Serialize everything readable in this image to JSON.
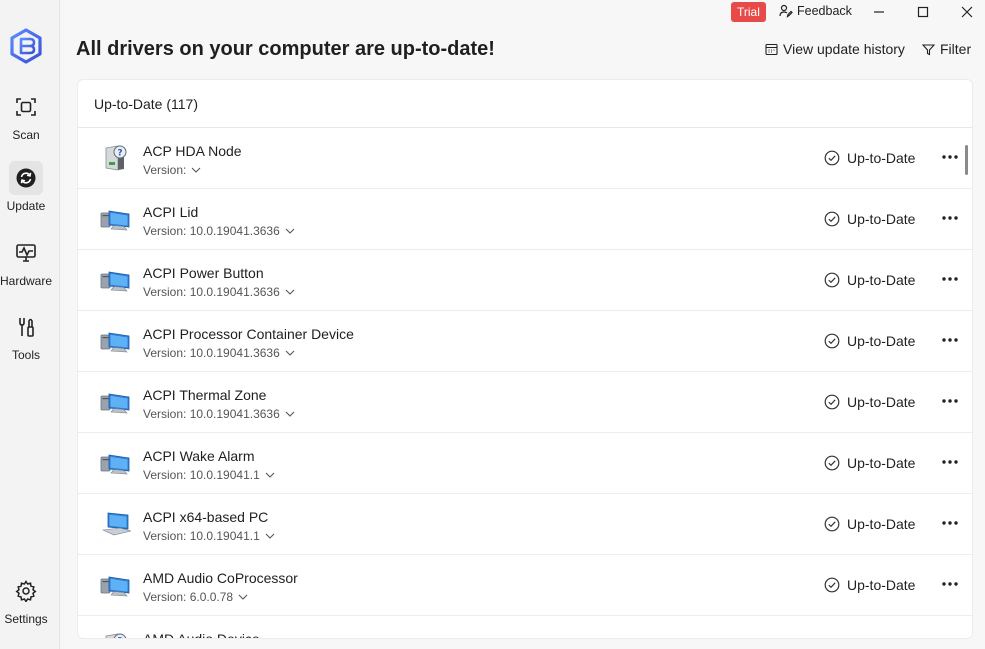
{
  "sidebar": {
    "items": [
      {
        "label": "Scan",
        "icon": "scan-icon"
      },
      {
        "label": "Update",
        "icon": "update-icon"
      },
      {
        "label": "Hardware",
        "icon": "hardware-icon"
      },
      {
        "label": "Tools",
        "icon": "tools-icon"
      }
    ],
    "settings_label": "Settings"
  },
  "titlebar": {
    "trial_label": "Trial",
    "feedback_label": "Feedback"
  },
  "header": {
    "headline": "All drivers on your computer are up-to-date!",
    "view_history_label": "View update history",
    "filter_label": "Filter"
  },
  "panel": {
    "section_title": "Up-to-Date (117)",
    "drivers": [
      {
        "name": "ACP HDA Node",
        "version": "Version:",
        "status": "Up-to-Date",
        "icon": "speaker-device-icon"
      },
      {
        "name": "ACPI Lid",
        "version": "Version: 10.0.19041.3636",
        "status": "Up-to-Date",
        "icon": "computer-monitor-icon"
      },
      {
        "name": "ACPI Power Button",
        "version": "Version: 10.0.19041.3636",
        "status": "Up-to-Date",
        "icon": "computer-monitor-icon"
      },
      {
        "name": "ACPI Processor Container Device",
        "version": "Version: 10.0.19041.3636",
        "status": "Up-to-Date",
        "icon": "computer-monitor-icon"
      },
      {
        "name": "ACPI Thermal Zone",
        "version": "Version: 10.0.19041.3636",
        "status": "Up-to-Date",
        "icon": "computer-monitor-icon"
      },
      {
        "name": "ACPI Wake Alarm",
        "version": "Version: 10.0.19041.1",
        "status": "Up-to-Date",
        "icon": "computer-monitor-icon"
      },
      {
        "name": "ACPI x64-based PC",
        "version": "Version: 10.0.19041.1",
        "status": "Up-to-Date",
        "icon": "laptop-icon"
      },
      {
        "name": "AMD Audio CoProcessor",
        "version": "Version: 6.0.0.78",
        "status": "Up-to-Date",
        "icon": "computer-monitor-icon"
      },
      {
        "name": "AMD Audio Device",
        "version": "",
        "status": "",
        "icon": "speaker-device-icon"
      }
    ]
  },
  "colors": {
    "accent": "#4a6cf7",
    "trial": "#e84a4a"
  }
}
